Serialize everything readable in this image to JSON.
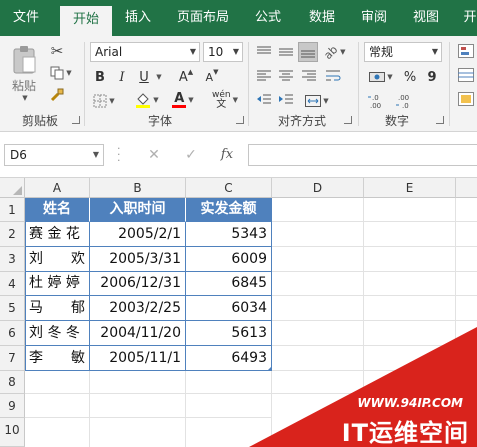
{
  "tabs": [
    "文件",
    "开始",
    "插入",
    "页面布局",
    "公式",
    "数据",
    "审阅",
    "视图",
    "开"
  ],
  "ribbon": {
    "clipboard_label": "剪贴板",
    "paste_label": "粘贴",
    "font_label": "字体",
    "font_name": "Arial",
    "font_size": "10",
    "bold": "B",
    "italic": "I",
    "underline": "U",
    "grow_font": "A",
    "shrink_font": "A",
    "wen": "wén",
    "align_label": "对齐方式",
    "number_label": "数字",
    "number_format": "常规",
    "percent": "%",
    "comma": "9"
  },
  "formula_bar": {
    "name_box": "D6",
    "fx": "fx",
    "cancel": "✕",
    "enter": "✓",
    "formula": ""
  },
  "columns": [
    "A",
    "B",
    "C",
    "D",
    "E"
  ],
  "rows": [
    "1",
    "2",
    "3",
    "4",
    "5",
    "6",
    "7",
    "8",
    "9",
    "10"
  ],
  "table": {
    "headers": [
      "姓名",
      "入职时间",
      "实发金额"
    ],
    "rows": [
      [
        "赛 金 花",
        "2005/2/1",
        "5343"
      ],
      [
        "刘　　欢",
        "2005/3/31",
        "6009"
      ],
      [
        "杜 婷 婷",
        "2006/12/31",
        "6845"
      ],
      [
        "马　　郁",
        "2003/2/25",
        "6034"
      ],
      [
        "刘 冬 冬",
        "2004/11/20",
        "5613"
      ],
      [
        "李　　敏",
        "2005/11/1",
        "6493"
      ]
    ]
  },
  "watermark": {
    "url": "WWW.94IP.COM",
    "name": "IT运维空间"
  },
  "colors": {
    "excel_green": "#217346",
    "header_blue": "#4f81bd",
    "watermark_red": "#d9231c"
  }
}
